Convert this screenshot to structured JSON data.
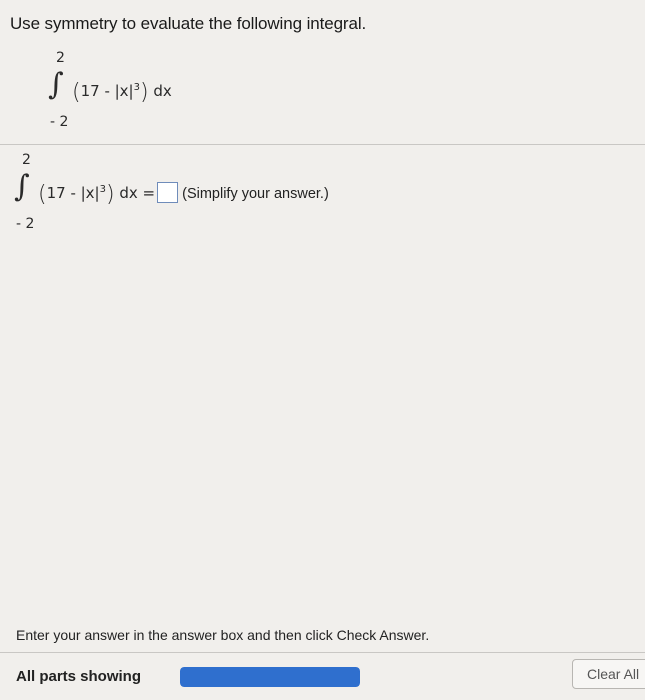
{
  "question": {
    "title": "Use symmetry to evaluate the following integral."
  },
  "display_integral": {
    "upper": "2",
    "lower": "- 2",
    "integrand_prefix": "17 - |x|",
    "exponent": "3",
    "differential": "dx"
  },
  "answer_line": {
    "upper": "2",
    "lower": "- 2",
    "integrand_prefix": "17 - |x|",
    "exponent": "3",
    "differential": "dx =",
    "answer_value": "",
    "hint": "(Simplify your answer.)"
  },
  "footer": {
    "instructions": "Enter your answer in the answer box and then click Check Answer.",
    "parts_label": "All parts showing",
    "progress_fraction": 1.0,
    "clear_label": "Clear All"
  },
  "colors": {
    "background": "#f1efec",
    "progress": "#2f6fce",
    "answer_box_border": "#6f8cba"
  }
}
